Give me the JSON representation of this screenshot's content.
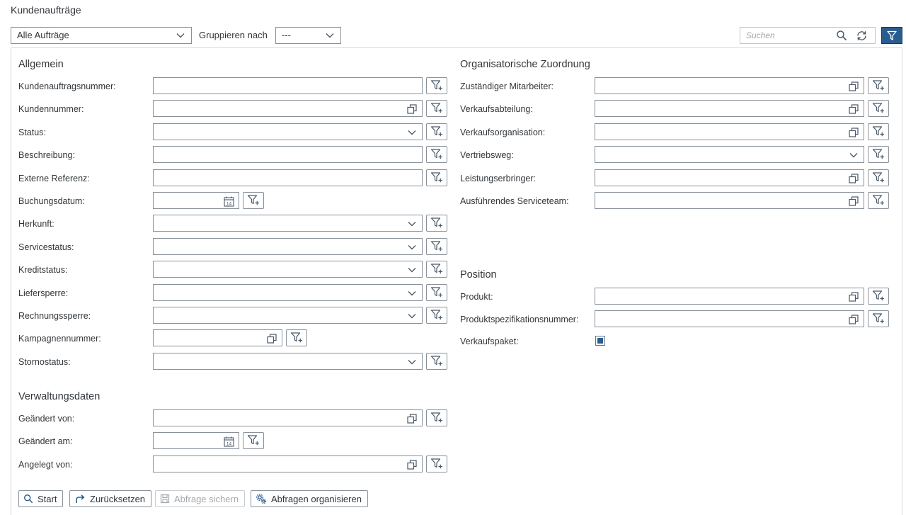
{
  "page": {
    "title": "Kundenaufträge"
  },
  "toolbar": {
    "view_selected": "Alle Aufträge",
    "group_label": "Gruppieren nach",
    "group_selected": "---",
    "search_placeholder": "Suchen"
  },
  "filters": {
    "allgemein": {
      "title": "Allgemein",
      "fields": [
        {
          "label": "Kundenauftragsnummer:",
          "type": "text",
          "value": ""
        },
        {
          "label": "Kundennummer:",
          "type": "valuehelp",
          "value": ""
        },
        {
          "label": "Status:",
          "type": "dropdown",
          "value": ""
        },
        {
          "label": "Beschreibung:",
          "type": "text",
          "value": ""
        },
        {
          "label": "Externe Referenz:",
          "type": "text",
          "value": ""
        },
        {
          "label": "Buchungsdatum:",
          "type": "date",
          "value": ""
        },
        {
          "label": "Herkunft:",
          "type": "dropdown",
          "value": ""
        },
        {
          "label": "Servicestatus:",
          "type": "dropdown",
          "value": ""
        },
        {
          "label": "Kreditstatus:",
          "type": "dropdown",
          "value": ""
        },
        {
          "label": "Liefersperre:",
          "type": "dropdown",
          "value": ""
        },
        {
          "label": "Rechnungssperre:",
          "type": "dropdown",
          "value": ""
        },
        {
          "label": "Kampagnennummer:",
          "type": "valuehelp",
          "value": ""
        },
        {
          "label": "Stornostatus:",
          "type": "dropdown",
          "value": ""
        }
      ]
    },
    "verwaltung": {
      "title": "Verwaltungsdaten",
      "fields": [
        {
          "label": "Geändert von:",
          "type": "valuehelp",
          "value": ""
        },
        {
          "label": "Geändert am:",
          "type": "date",
          "value": ""
        },
        {
          "label": "Angelegt von:",
          "type": "valuehelp",
          "value": ""
        }
      ]
    },
    "organisation": {
      "title": "Organisatorische Zuordnung",
      "fields": [
        {
          "label": "Zuständiger Mitarbeiter:",
          "type": "valuehelp",
          "value": ""
        },
        {
          "label": "Verkaufsabteilung:",
          "type": "valuehelp",
          "value": ""
        },
        {
          "label": "Verkaufsorganisation:",
          "type": "valuehelp",
          "value": ""
        },
        {
          "label": "Vertriebsweg:",
          "type": "dropdown",
          "value": ""
        },
        {
          "label": "Leistungserbringer:",
          "type": "valuehelp",
          "value": ""
        },
        {
          "label": "Ausführendes Serviceteam:",
          "type": "valuehelp",
          "value": ""
        }
      ]
    },
    "position": {
      "title": "Position",
      "fields": [
        {
          "label": "Produkt:",
          "type": "valuehelp",
          "value": ""
        },
        {
          "label": "Produktspezifikationsnummer:",
          "type": "valuehelp",
          "value": ""
        }
      ],
      "checkbox_label": "Verkaufspaket:",
      "checkbox_state": "indeterminate"
    }
  },
  "actions": {
    "start": "Start",
    "reset": "Zurücksetzen",
    "save_query": "Abfrage sichern",
    "organize": "Abfragen organisieren"
  },
  "icons": {
    "date": "calendar-icon",
    "valuehelp": "value-help-icon",
    "dropdown": "chevron-down-icon",
    "filter": "add-filter-icon"
  },
  "colors": {
    "accent": "#2a5d8f",
    "border": "#89919a",
    "text": "#32363a"
  }
}
